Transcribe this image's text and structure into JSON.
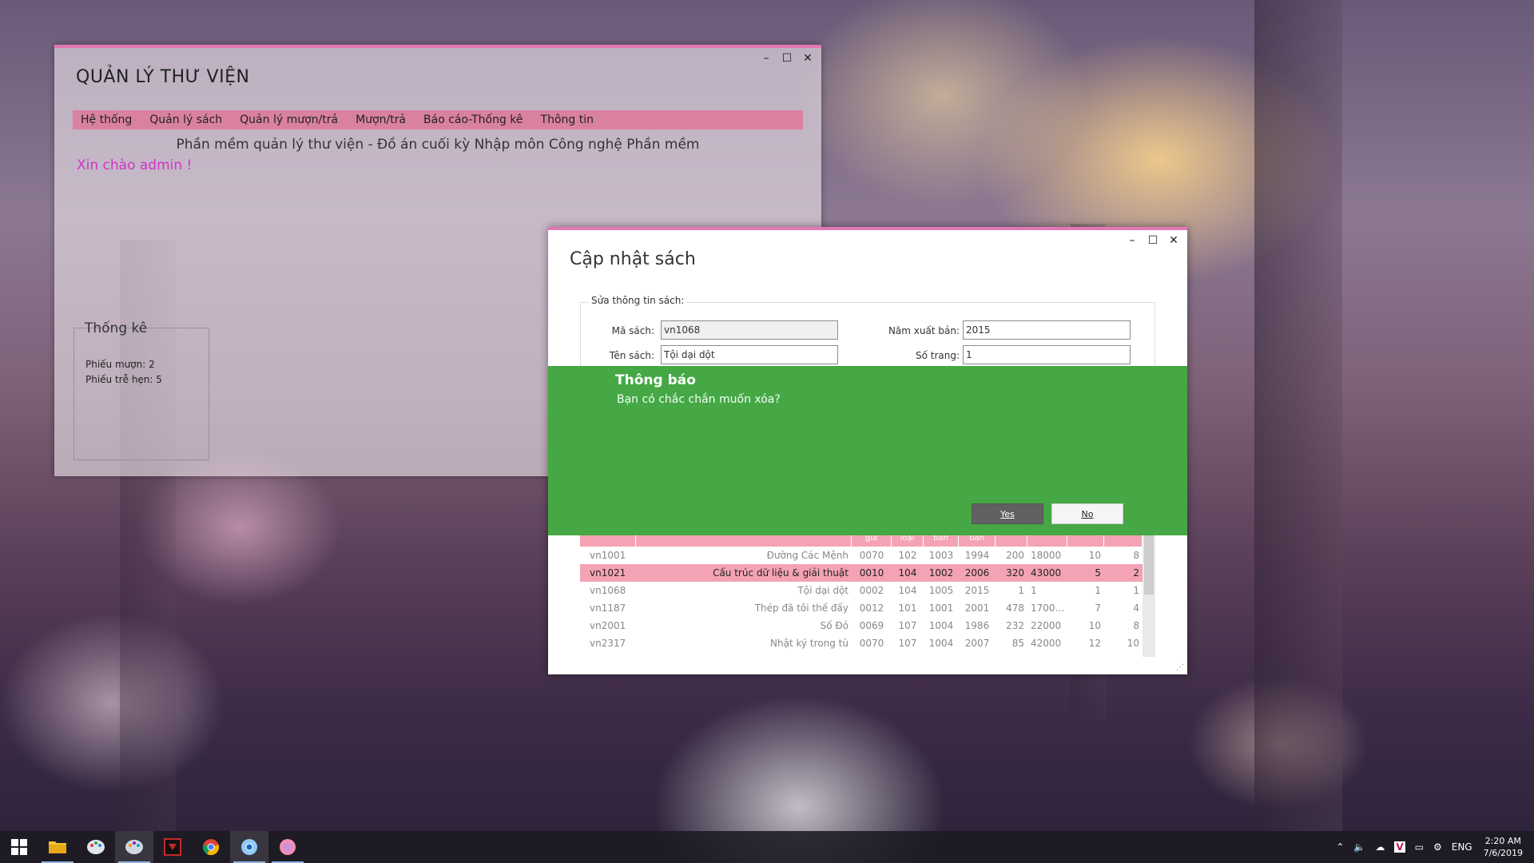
{
  "main_window": {
    "title": "QUẢN LÝ THƯ VIỆN",
    "menu": [
      "Hệ thống",
      "Quản lý sách",
      "Quản lý mượn/trả",
      "Mượn/trả",
      "Báo cáo-Thống kê",
      "Thông tin"
    ],
    "subtitle": "Phần mềm quản lý thư viện - Đồ án cuối kỳ Nhập môn Công nghệ Phần mềm",
    "welcome": "Xin chào admin !",
    "stats": {
      "title": "Thống kê",
      "borrow_slips": "Phiếu mượn: 2",
      "late_slips": "Phiếu trễ hẹn: 5"
    },
    "controls": {
      "minimize": "–",
      "maximize": "☐",
      "close": "✕"
    }
  },
  "dialog": {
    "title": "Cập nhật sách",
    "group_label": "Sửa thông tin sách:",
    "fields": {
      "book_id_label": "Mã sách:",
      "book_id_value": "vn1068",
      "book_name_label": "Tên sách:",
      "book_name_value": "Tội dại dột",
      "year_label": "Năm xuất bản:",
      "year_value": "2015",
      "pages_label": "Số trang:",
      "pages_value": "1"
    },
    "notification": {
      "title": "Thông báo",
      "message": "Bạn có chắc chắn muốn xóa?",
      "yes": "Yes",
      "no": "No"
    },
    "grid": {
      "header_fragments": [
        "giả",
        "loại",
        "bản",
        "bản"
      ],
      "rows": [
        [
          "vn1001",
          "Đường Các Mệnh",
          "0070",
          "102",
          "1003",
          "1994",
          "200",
          "18000",
          "10",
          "8"
        ],
        [
          "vn1021",
          "Cấu trúc dữ liệu & giải thuật",
          "0010",
          "104",
          "1002",
          "2006",
          "320",
          "43000",
          "5",
          "2"
        ],
        [
          "vn1068",
          "Tội dại dột",
          "0002",
          "104",
          "1005",
          "2015",
          "1",
          "1",
          "1",
          "1"
        ],
        [
          "vn1187",
          "Thép đã tôi thế đấy",
          "0012",
          "101",
          "1001",
          "2001",
          "478",
          "1700...",
          "7",
          "4"
        ],
        [
          "vn2001",
          "Số Đỏ",
          "0069",
          "107",
          "1004",
          "1986",
          "232",
          "22000",
          "10",
          "8"
        ],
        [
          "vn2317",
          "Nhật ký trong tù",
          "0070",
          "107",
          "1004",
          "2007",
          "85",
          "42000",
          "12",
          "10"
        ]
      ],
      "selected_row": 1
    }
  },
  "taskbar": {
    "apps": [
      "start-button",
      "file-explorer",
      "paint-app",
      "paint-app-2",
      "media-app",
      "chrome",
      "chrome-dev",
      "pink-app"
    ],
    "tray": {
      "language": "ENG",
      "time": "2:20 AM",
      "date": "7/6/2019"
    }
  },
  "colors": {
    "accent_pink": "#e277b5",
    "menu_pink": "#e27096",
    "notify_green": "#45a845",
    "grid_pink": "#f4a3b5"
  }
}
